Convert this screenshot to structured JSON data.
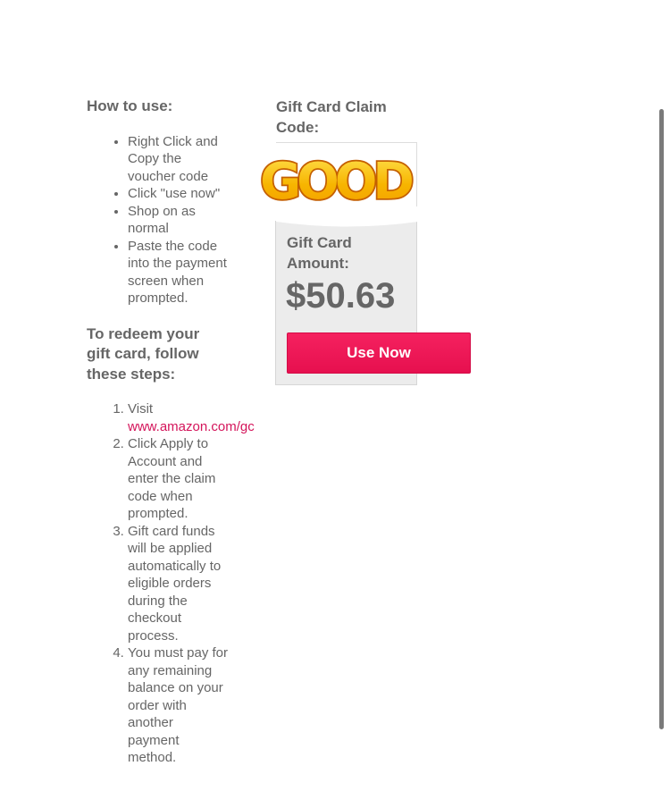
{
  "how_to_use": {
    "title": "How to use:",
    "items": [
      "Right Click and Copy the voucher code",
      "Click \"use now\"",
      "Shop on as normal",
      "Paste the code into the payment screen when prompted."
    ]
  },
  "redeem": {
    "title": "To redeem your gift card, follow these steps:",
    "step1_prefix": "Visit",
    "step1_link": "www.amazon.com/gc",
    "steps": [
      "Click Apply to Account and enter the claim code when prompted.",
      "Gift card funds will be applied automatically to eligible orders during the checkout process.",
      "You must pay for any remaining balance on your order with another payment method."
    ]
  },
  "claim": {
    "title": "Gift Card Claim Code:",
    "code_image_text": "GOOD"
  },
  "card": {
    "amount_label": "Gift Card Amount:",
    "amount_value": "$50.63",
    "button_label": "Use Now"
  },
  "colors": {
    "text": "#666666",
    "link": "#d4145a",
    "button": "#f0155a",
    "card_bg": "#ececec",
    "logo_fill": "#f7b500",
    "logo_outline": "#d06a00"
  }
}
